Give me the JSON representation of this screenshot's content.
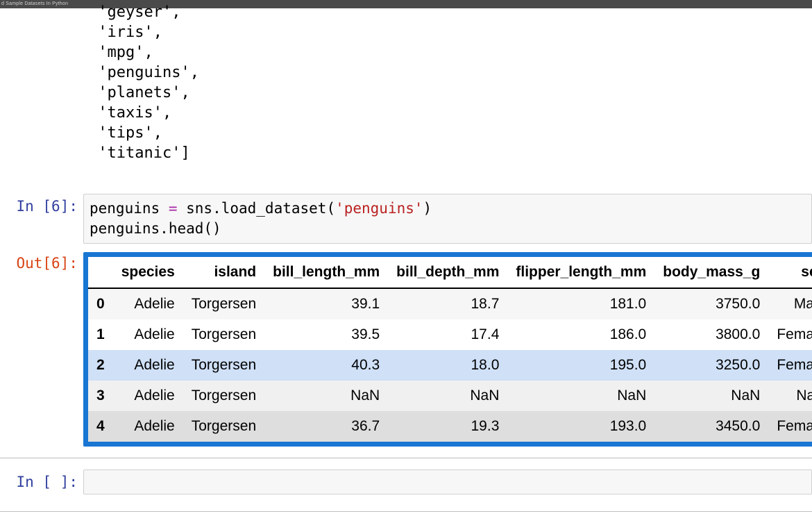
{
  "topbar": {
    "title": "d Sample Datasets In Python"
  },
  "prev_output": {
    "lines": [
      " 'geyser',",
      " 'iris',",
      " 'mpg',",
      " 'penguins',",
      " 'planets',",
      " 'taxis',",
      " 'tips',",
      " 'titanic']"
    ]
  },
  "cell6": {
    "in_prompt": "In [6]:",
    "out_prompt": "Out[6]:",
    "code": {
      "t_var1": "penguins",
      "t_sp1": " ",
      "t_eq": "=",
      "t_sp2": " ",
      "t_mod": "sns",
      "t_dot1": ".",
      "t_fn": "load_dataset",
      "t_lpar": "(",
      "t_str": "'penguins'",
      "t_rpar": ")",
      "t_nl": "\n",
      "t_var2": "penguins",
      "t_dot2": ".",
      "t_head": "head",
      "t_lpar2": "(",
      "t_rpar2": ")"
    }
  },
  "table": {
    "columns": [
      "species",
      "island",
      "bill_length_mm",
      "bill_depth_mm",
      "flipper_length_mm",
      "body_mass_g",
      "sex"
    ],
    "index": [
      "0",
      "1",
      "2",
      "3",
      "4"
    ],
    "rows": [
      {
        "species": "Adelie",
        "island": "Torgersen",
        "bill_length_mm": "39.1",
        "bill_depth_mm": "18.7",
        "flipper_length_mm": "181.0",
        "body_mass_g": "3750.0",
        "sex": "Male"
      },
      {
        "species": "Adelie",
        "island": "Torgersen",
        "bill_length_mm": "39.5",
        "bill_depth_mm": "17.4",
        "flipper_length_mm": "186.0",
        "body_mass_g": "3800.0",
        "sex": "Female"
      },
      {
        "species": "Adelie",
        "island": "Torgersen",
        "bill_length_mm": "40.3",
        "bill_depth_mm": "18.0",
        "flipper_length_mm": "195.0",
        "body_mass_g": "3250.0",
        "sex": "Female"
      },
      {
        "species": "Adelie",
        "island": "Torgersen",
        "bill_length_mm": "NaN",
        "bill_depth_mm": "NaN",
        "flipper_length_mm": "NaN",
        "body_mass_g": "NaN",
        "sex": "NaN"
      },
      {
        "species": "Adelie",
        "island": "Torgersen",
        "bill_length_mm": "36.7",
        "bill_depth_mm": "19.3",
        "flipper_length_mm": "193.0",
        "body_mass_g": "3450.0",
        "sex": "Female"
      }
    ]
  },
  "empty_cell": {
    "in_prompt": "In [ ]:"
  },
  "chart_data": {
    "type": "table",
    "title": "penguins.head()",
    "columns": [
      "species",
      "island",
      "bill_length_mm",
      "bill_depth_mm",
      "flipper_length_mm",
      "body_mass_g",
      "sex"
    ],
    "index": [
      0,
      1,
      2,
      3,
      4
    ],
    "data": [
      [
        "Adelie",
        "Torgersen",
        39.1,
        18.7,
        181.0,
        3750.0,
        "Male"
      ],
      [
        "Adelie",
        "Torgersen",
        39.5,
        17.4,
        186.0,
        3800.0,
        "Female"
      ],
      [
        "Adelie",
        "Torgersen",
        40.3,
        18.0,
        195.0,
        3250.0,
        "Female"
      ],
      [
        "Adelie",
        "Torgersen",
        null,
        null,
        null,
        null,
        null
      ],
      [
        "Adelie",
        "Torgersen",
        36.7,
        19.3,
        193.0,
        3450.0,
        "Female"
      ]
    ]
  }
}
